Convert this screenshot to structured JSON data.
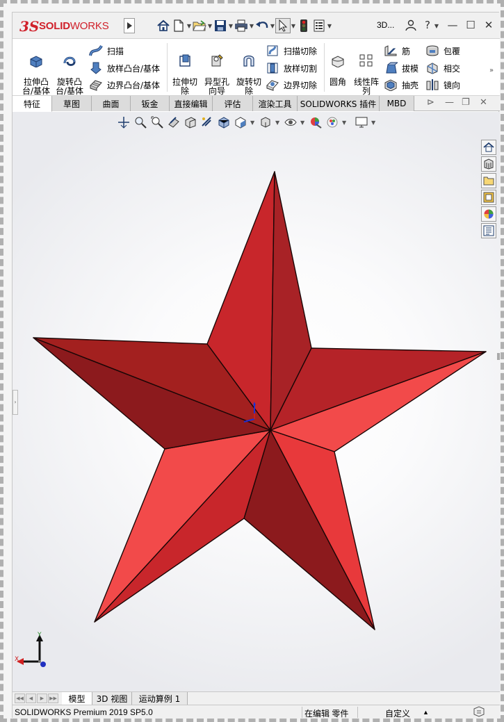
{
  "app": {
    "logo_mark": "3S",
    "logo_text_bold": "SOLID",
    "logo_text_light": "WORKS",
    "search_label": "3D..."
  },
  "quick_access": {
    "icons": [
      "home-icon",
      "new-document-icon",
      "open-folder-icon",
      "save-icon",
      "print-icon",
      "undo-icon",
      "select-pointer-icon",
      "traffic-light-icon",
      "options-icon"
    ]
  },
  "ribbon": {
    "extrude_boss": "拉伸凸\n台/基体",
    "revolve_boss": "旋转凸\n台/基体",
    "sweep": "扫描",
    "loft_boss": "放样凸台/基体",
    "boundary_boss": "边界凸台/基体",
    "extrude_cut": "拉伸切\n除",
    "hole_wizard": "异型孔\n向导",
    "revolve_cut": "旋转切\n除",
    "sweep_cut": "扫描切除",
    "loft_cut": "放样切割",
    "boundary_cut": "边界切除",
    "fillet": "圆角",
    "linear_pattern": "线性阵\n列",
    "rib": "筋",
    "draft": "拔模",
    "shell": "抽壳",
    "wrap": "包覆",
    "intersect": "相交",
    "mirror": "镜向"
  },
  "tabs": [
    {
      "label": "特征"
    },
    {
      "label": "草图"
    },
    {
      "label": "曲面"
    },
    {
      "label": "钣金"
    },
    {
      "label": "直接编辑"
    },
    {
      "label": "评估"
    },
    {
      "label": "渲染工具"
    },
    {
      "label": "SOLIDWORKS 插件"
    },
    {
      "label": "MBD"
    }
  ],
  "triad": {
    "x": "X",
    "y": "Y"
  },
  "model": {
    "color_main": "#c8262b",
    "color_light": "#f24a4a",
    "color_dark": "#8c1a1d"
  },
  "bottom_tabs": [
    {
      "label": "模型"
    },
    {
      "label": "3D 视图"
    },
    {
      "label": "运动算例 1"
    }
  ],
  "status": {
    "product": "SOLIDWORKS Premium 2019 SP5.0",
    "editing": "在编辑 零件",
    "units": "自定义"
  }
}
